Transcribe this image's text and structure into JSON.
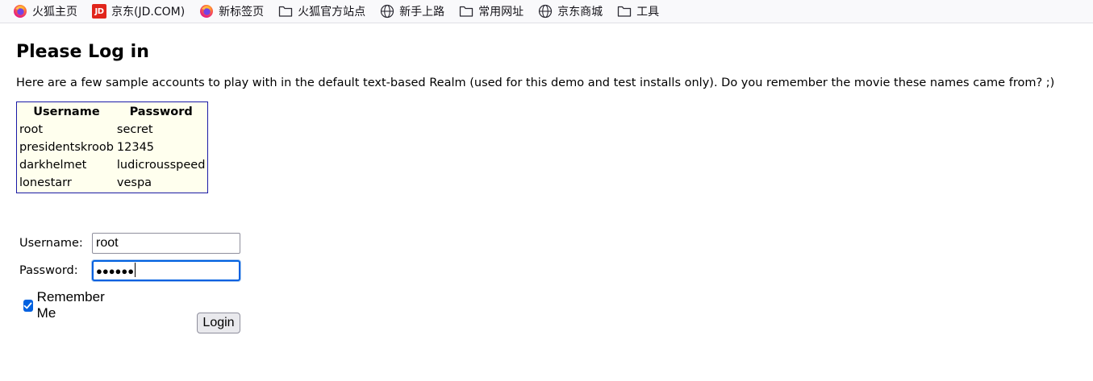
{
  "bookmarks": [
    {
      "label": "火狐主页",
      "icon": "firefox-icon"
    },
    {
      "label": "京东(JD.COM)",
      "icon": "jd-icon",
      "badge": "JD"
    },
    {
      "label": "新标签页",
      "icon": "firefox-icon"
    },
    {
      "label": "火狐官方站点",
      "icon": "folder-icon"
    },
    {
      "label": "新手上路",
      "icon": "globe-icon"
    },
    {
      "label": "常用网址",
      "icon": "folder-icon"
    },
    {
      "label": "京东商城",
      "icon": "globe-icon"
    },
    {
      "label": "工具",
      "icon": "folder-icon"
    }
  ],
  "page": {
    "title": "Please Log in",
    "intro": "Here are a few sample accounts to play with in the default text-based Realm (used for this demo and test installs only). Do you remember the movie these names came from? ;)"
  },
  "accounts_table": {
    "headers": [
      "Username",
      "Password"
    ],
    "rows": [
      [
        "root",
        "secret"
      ],
      [
        "presidentskroob",
        "12345"
      ],
      [
        "darkhelmet",
        "ludicrousspeed"
      ],
      [
        "lonestarr",
        "vespa"
      ]
    ]
  },
  "login_form": {
    "username_label": "Username:",
    "username_value": "root",
    "password_label": "Password:",
    "password_mask": "●●●●●●",
    "remember_label": "Remember Me",
    "remember_checked": true,
    "login_button": "Login"
  },
  "colors": {
    "table_border": "#1a1aa6",
    "table_background": "#ffffee",
    "focus_ring": "#0061e0",
    "jd_brand": "#e1251b"
  }
}
